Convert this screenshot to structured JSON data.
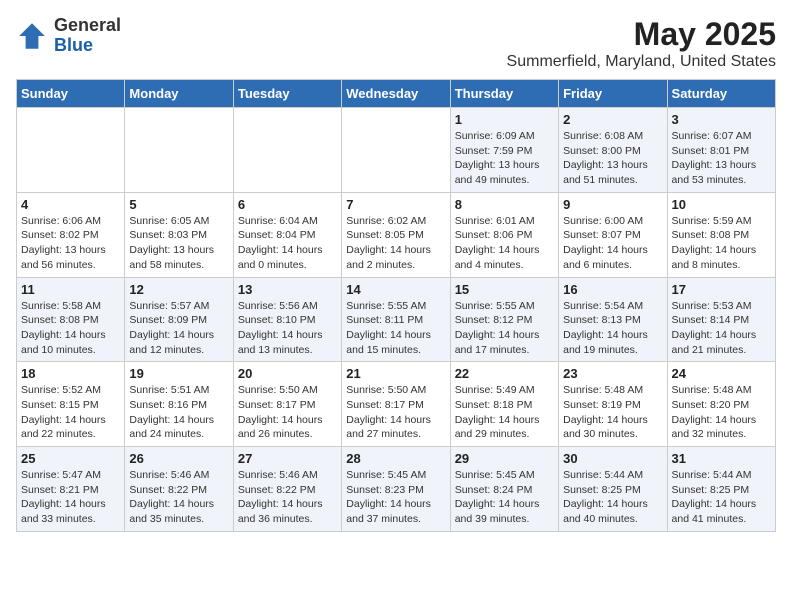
{
  "logo": {
    "general": "General",
    "blue": "Blue"
  },
  "title": "May 2025",
  "subtitle": "Summerfield, Maryland, United States",
  "days_of_week": [
    "Sunday",
    "Monday",
    "Tuesday",
    "Wednesday",
    "Thursday",
    "Friday",
    "Saturday"
  ],
  "weeks": [
    [
      {
        "day": "",
        "info": ""
      },
      {
        "day": "",
        "info": ""
      },
      {
        "day": "",
        "info": ""
      },
      {
        "day": "",
        "info": ""
      },
      {
        "day": "1",
        "info": "Sunrise: 6:09 AM\nSunset: 7:59 PM\nDaylight: 13 hours\nand 49 minutes."
      },
      {
        "day": "2",
        "info": "Sunrise: 6:08 AM\nSunset: 8:00 PM\nDaylight: 13 hours\nand 51 minutes."
      },
      {
        "day": "3",
        "info": "Sunrise: 6:07 AM\nSunset: 8:01 PM\nDaylight: 13 hours\nand 53 minutes."
      }
    ],
    [
      {
        "day": "4",
        "info": "Sunrise: 6:06 AM\nSunset: 8:02 PM\nDaylight: 13 hours\nand 56 minutes."
      },
      {
        "day": "5",
        "info": "Sunrise: 6:05 AM\nSunset: 8:03 PM\nDaylight: 13 hours\nand 58 minutes."
      },
      {
        "day": "6",
        "info": "Sunrise: 6:04 AM\nSunset: 8:04 PM\nDaylight: 14 hours\nand 0 minutes."
      },
      {
        "day": "7",
        "info": "Sunrise: 6:02 AM\nSunset: 8:05 PM\nDaylight: 14 hours\nand 2 minutes."
      },
      {
        "day": "8",
        "info": "Sunrise: 6:01 AM\nSunset: 8:06 PM\nDaylight: 14 hours\nand 4 minutes."
      },
      {
        "day": "9",
        "info": "Sunrise: 6:00 AM\nSunset: 8:07 PM\nDaylight: 14 hours\nand 6 minutes."
      },
      {
        "day": "10",
        "info": "Sunrise: 5:59 AM\nSunset: 8:08 PM\nDaylight: 14 hours\nand 8 minutes."
      }
    ],
    [
      {
        "day": "11",
        "info": "Sunrise: 5:58 AM\nSunset: 8:08 PM\nDaylight: 14 hours\nand 10 minutes."
      },
      {
        "day": "12",
        "info": "Sunrise: 5:57 AM\nSunset: 8:09 PM\nDaylight: 14 hours\nand 12 minutes."
      },
      {
        "day": "13",
        "info": "Sunrise: 5:56 AM\nSunset: 8:10 PM\nDaylight: 14 hours\nand 13 minutes."
      },
      {
        "day": "14",
        "info": "Sunrise: 5:55 AM\nSunset: 8:11 PM\nDaylight: 14 hours\nand 15 minutes."
      },
      {
        "day": "15",
        "info": "Sunrise: 5:55 AM\nSunset: 8:12 PM\nDaylight: 14 hours\nand 17 minutes."
      },
      {
        "day": "16",
        "info": "Sunrise: 5:54 AM\nSunset: 8:13 PM\nDaylight: 14 hours\nand 19 minutes."
      },
      {
        "day": "17",
        "info": "Sunrise: 5:53 AM\nSunset: 8:14 PM\nDaylight: 14 hours\nand 21 minutes."
      }
    ],
    [
      {
        "day": "18",
        "info": "Sunrise: 5:52 AM\nSunset: 8:15 PM\nDaylight: 14 hours\nand 22 minutes."
      },
      {
        "day": "19",
        "info": "Sunrise: 5:51 AM\nSunset: 8:16 PM\nDaylight: 14 hours\nand 24 minutes."
      },
      {
        "day": "20",
        "info": "Sunrise: 5:50 AM\nSunset: 8:17 PM\nDaylight: 14 hours\nand 26 minutes."
      },
      {
        "day": "21",
        "info": "Sunrise: 5:50 AM\nSunset: 8:17 PM\nDaylight: 14 hours\nand 27 minutes."
      },
      {
        "day": "22",
        "info": "Sunrise: 5:49 AM\nSunset: 8:18 PM\nDaylight: 14 hours\nand 29 minutes."
      },
      {
        "day": "23",
        "info": "Sunrise: 5:48 AM\nSunset: 8:19 PM\nDaylight: 14 hours\nand 30 minutes."
      },
      {
        "day": "24",
        "info": "Sunrise: 5:48 AM\nSunset: 8:20 PM\nDaylight: 14 hours\nand 32 minutes."
      }
    ],
    [
      {
        "day": "25",
        "info": "Sunrise: 5:47 AM\nSunset: 8:21 PM\nDaylight: 14 hours\nand 33 minutes."
      },
      {
        "day": "26",
        "info": "Sunrise: 5:46 AM\nSunset: 8:22 PM\nDaylight: 14 hours\nand 35 minutes."
      },
      {
        "day": "27",
        "info": "Sunrise: 5:46 AM\nSunset: 8:22 PM\nDaylight: 14 hours\nand 36 minutes."
      },
      {
        "day": "28",
        "info": "Sunrise: 5:45 AM\nSunset: 8:23 PM\nDaylight: 14 hours\nand 37 minutes."
      },
      {
        "day": "29",
        "info": "Sunrise: 5:45 AM\nSunset: 8:24 PM\nDaylight: 14 hours\nand 39 minutes."
      },
      {
        "day": "30",
        "info": "Sunrise: 5:44 AM\nSunset: 8:25 PM\nDaylight: 14 hours\nand 40 minutes."
      },
      {
        "day": "31",
        "info": "Sunrise: 5:44 AM\nSunset: 8:25 PM\nDaylight: 14 hours\nand 41 minutes."
      }
    ]
  ]
}
